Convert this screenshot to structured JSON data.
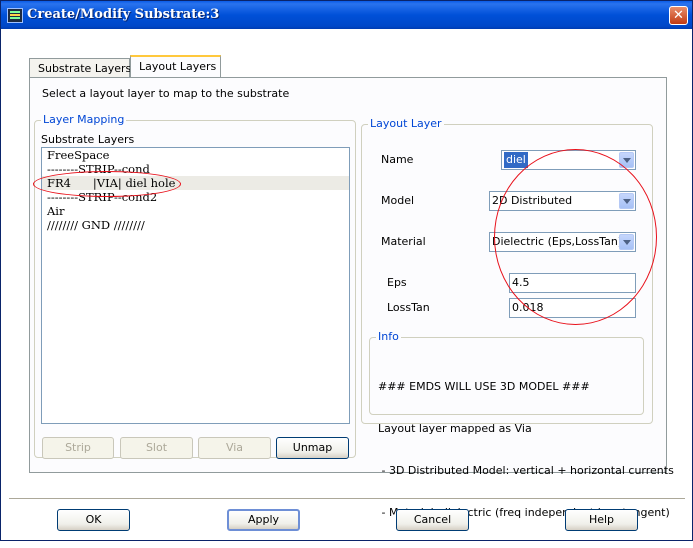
{
  "window": {
    "title": "Create/Modify Substrate:3",
    "close_label": "✕"
  },
  "tabs": [
    {
      "label": "Substrate Layers"
    },
    {
      "label": "Layout Layers"
    }
  ],
  "hint": "Select a layout layer to map to the substrate",
  "layer_mapping": {
    "title": "Layer Mapping",
    "list_label": "Substrate Layers",
    "items": [
      "FreeSpace",
      "--------STRIP--cond",
      "FR4      |VIA| diel hole",
      "--------STRIP--cond2",
      "Air",
      "//////// GND ////////"
    ],
    "selected_index": 2,
    "buttons": {
      "strip": "Strip",
      "slot": "Slot",
      "via": "Via",
      "unmap": "Unmap"
    }
  },
  "layout_layer": {
    "title": "Layout Layer",
    "name_label": "Name",
    "name_value": "diel",
    "model_label": "Model",
    "model_value": "2D Distributed",
    "material_label": "Material",
    "material_value": "Dielectric (Eps,LossTan)",
    "eps_label": "Eps",
    "eps_value": "4.5",
    "losstan_label": "LossTan",
    "losstan_value": "0.018"
  },
  "info": {
    "title": "Info",
    "lines": [
      "### EMDS WILL USE 3D MODEL ###",
      "Layout layer mapped as Via",
      " - 3D Distributed Model: vertical + horizontal currents",
      " - Material: dielectric (freq independent loss tangent)"
    ]
  },
  "footer": {
    "ok": "OK",
    "apply": "Apply",
    "cancel": "Cancel",
    "help": "Help"
  },
  "colors": {
    "group_title": "#0046d5",
    "annotation": "#e8101a",
    "selection": "#316ac5"
  }
}
